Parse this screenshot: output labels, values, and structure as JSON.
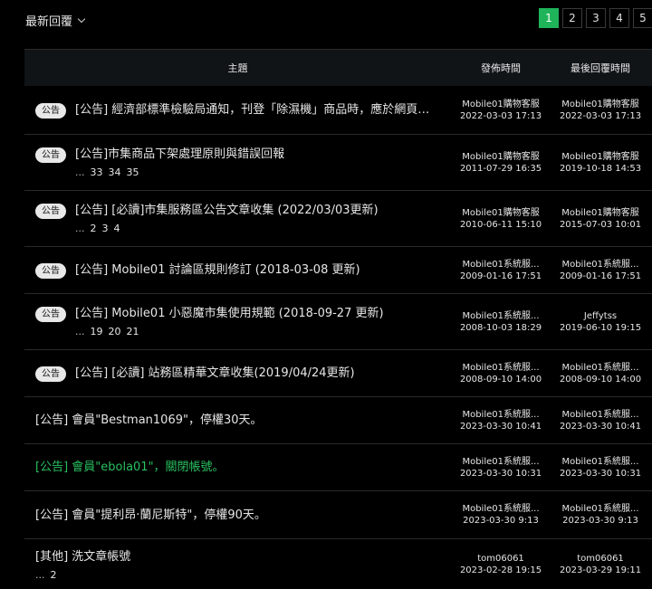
{
  "sort": {
    "label": "最新回覆"
  },
  "pagination": [
    "1",
    "2",
    "3",
    "4",
    "5"
  ],
  "table": {
    "headers": {
      "topic": "主題",
      "posted": "發佈時間",
      "last_reply": "最後回覆時間"
    },
    "rows": [
      {
        "badge": "公告",
        "title": "[公告] 經濟部標準檢驗局通知，刊登「除濕機」商品時，應於網頁明確...",
        "pages": [],
        "post_user": "Mobile01購物客服",
        "post_time": "2022-03-03 17:13",
        "last_user": "Mobile01購物客服",
        "last_time": "2022-03-03 17:13"
      },
      {
        "badge": "公告",
        "title": "[公告]市集商品下架處理原則與錯誤回報",
        "pages": [
          "33",
          "34",
          "35"
        ],
        "post_user": "Mobile01購物客服",
        "post_time": "2011-07-29 16:35",
        "last_user": "Mobile01購物客服",
        "last_time": "2019-10-18 14:53"
      },
      {
        "badge": "公告",
        "title": "[公告] [必讀]市集服務區公告文章收集 (2022/03/03更新)",
        "pages": [
          "2",
          "3",
          "4"
        ],
        "post_user": "Mobile01購物客服",
        "post_time": "2010-06-11 15:10",
        "last_user": "Mobile01購物客服",
        "last_time": "2015-07-03 10:01"
      },
      {
        "badge": "公告",
        "title": "[公告] Mobile01 討論區規則修訂 (2018-03-08 更新)",
        "pages": [],
        "post_user": "Mobile01系統服...",
        "post_time": "2009-01-16 17:51",
        "last_user": "Mobile01系統服...",
        "last_time": "2009-01-16 17:51"
      },
      {
        "badge": "公告",
        "title": "[公告] Mobile01 小惡魔市集使用規範 (2018-09-27 更新)",
        "pages": [
          "19",
          "20",
          "21"
        ],
        "post_user": "Mobile01系統服...",
        "post_time": "2008-10-03 18:29",
        "last_user": "Jeffytss",
        "last_time": "2019-06-10 19:15"
      },
      {
        "badge": "公告",
        "title": "[公告] [必讀] 站務區精華文章收集(2019/04/24更新)",
        "pages": [],
        "post_user": "Mobile01系統服...",
        "post_time": "2008-09-10 14:00",
        "last_user": "Mobile01系統服...",
        "last_time": "2008-09-10 14:00"
      },
      {
        "badge": "",
        "title": "[公告] 會員\"Bestman1069\"，停權30天。",
        "pages": [],
        "post_user": "Mobile01系統服...",
        "post_time": "2023-03-30 10:41",
        "last_user": "Mobile01系統服...",
        "last_time": "2023-03-30 10:41"
      },
      {
        "badge": "",
        "title": "[公告] 會員\"ebola01\"，關閉帳號。",
        "pages": [],
        "highlight": true,
        "post_user": "Mobile01系統服...",
        "post_time": "2023-03-30 10:31",
        "last_user": "Mobile01系統服...",
        "last_time": "2023-03-30 10:31"
      },
      {
        "badge": "",
        "title": "[公告] 會員\"提利昂·蘭尼斯特\"，停權90天。",
        "pages": [],
        "post_user": "Mobile01系統服...",
        "post_time": "2023-03-30 9:13",
        "last_user": "Mobile01系統服...",
        "last_time": "2023-03-30 9:13"
      },
      {
        "badge": "",
        "title": "[其他] 洗文章帳號",
        "pages": [
          "2"
        ],
        "post_user": "tom06061",
        "post_time": "2023-02-28 19:15",
        "last_user": "tom06061",
        "last_time": "2023-03-29 19:11"
      }
    ]
  }
}
